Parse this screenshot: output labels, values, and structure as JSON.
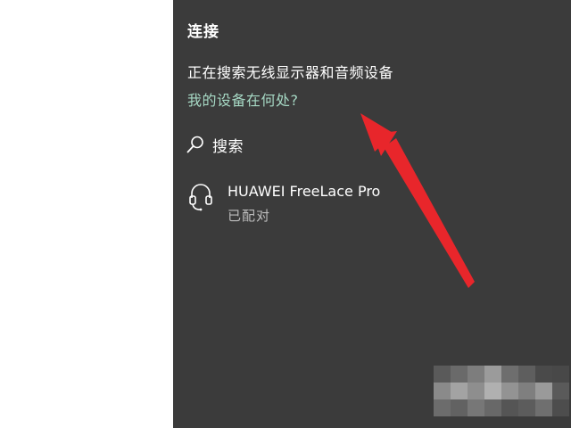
{
  "panel": {
    "title": "连接",
    "status_text": "正在搜索无线显示器和音频设备",
    "help_link": "我的设备在何处?"
  },
  "search": {
    "label": "搜索",
    "icon": "search-icon"
  },
  "devices": [
    {
      "name": "HUAWEI FreeLace Pro",
      "status": "已配对",
      "icon": "headset-icon"
    }
  ],
  "colors": {
    "panel_background": "#3b3b3b",
    "link": "#a6d8c4",
    "secondary_text": "#bdbdbd",
    "annotation_arrow": "#e8262b"
  }
}
